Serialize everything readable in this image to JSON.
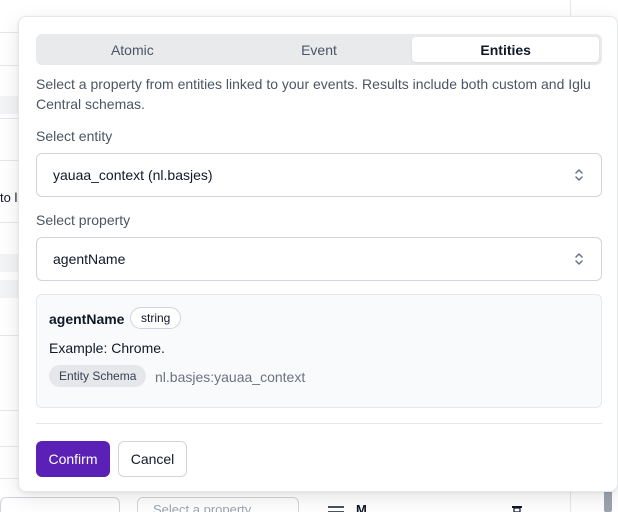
{
  "background": {
    "fragment_text": "to l",
    "bottom_select_placeholder": "Select a property",
    "bottom_label": "M"
  },
  "tabs": [
    {
      "label": "Atomic",
      "active": false
    },
    {
      "label": "Event",
      "active": false
    },
    {
      "label": "Entities",
      "active": true
    }
  ],
  "description": "Select a property from entities linked to your events. Results include both custom and Iglu Central schemas.",
  "entity": {
    "label": "Select entity",
    "value": "yauaa_context (nl.basjes)"
  },
  "property": {
    "label": "Select property",
    "value": "agentName"
  },
  "details": {
    "name": "agentName",
    "type": "string",
    "example": "Example: Chrome.",
    "schema_badge": "Entity Schema",
    "schema_value": "nl.basjes:yauaa_context"
  },
  "actions": {
    "confirm": "Confirm",
    "cancel": "Cancel"
  },
  "colors": {
    "primary": "#5b21b6",
    "tab_track": "#e9eaec"
  },
  "icons": {
    "select_chevron": "chevron-up-down-icon"
  }
}
